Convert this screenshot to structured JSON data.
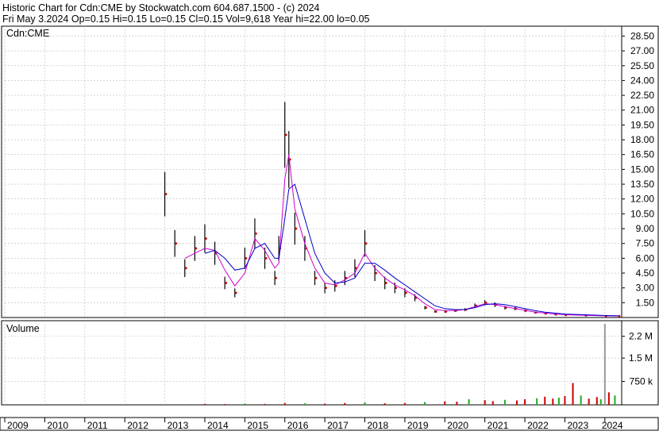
{
  "header": {
    "line1": "Historic Chart for Cdn:CME by Stockwatch.com 604.687.1500 - (c) 2024",
    "line2": "Fri May  3.2024   Op=0.15  Hi=0.15  Lo=0.15  Cl=0.15  Vol=9,618  Year hi=22.00  lo=0.05"
  },
  "colors": {
    "bars": "#000000",
    "close_dots": "#cc0000",
    "ma_short": "#cc00cc",
    "ma_long": "#0000cc",
    "volume_up": "#22aa22",
    "volume_down": "#cc0000",
    "grid": "#bdbdbd"
  },
  "chart_data": [
    {
      "type": "line",
      "title": "Cdn:CME",
      "xlabel": "",
      "ylabel": "",
      "ylim": [
        0,
        29.5
      ],
      "x_ticks": [
        "2009",
        "2010",
        "2011",
        "2012",
        "2013",
        "2014",
        "2015",
        "2016",
        "2017",
        "2018",
        "2019",
        "2020",
        "2021",
        "2022",
        "2023",
        "2024"
      ],
      "y_ticks": [
        "28.50",
        "27.00",
        "25.50",
        "24.00",
        "22.50",
        "21.00",
        "19.50",
        "18.00",
        "16.50",
        "15.00",
        "13.50",
        "12.00",
        "10.50",
        "9.00",
        "7.50",
        "6.00",
        "4.50",
        "3.00",
        "1.50"
      ],
      "grid": true,
      "x": [
        2013.0,
        2013.25,
        2013.5,
        2013.75,
        2014.0,
        2014.25,
        2014.5,
        2014.75,
        2015.0,
        2015.25,
        2015.5,
        2015.75,
        2015.85,
        2016.0,
        2016.1,
        2016.25,
        2016.5,
        2016.75,
        2017.0,
        2017.25,
        2017.5,
        2017.75,
        2018.0,
        2018.25,
        2018.5,
        2018.75,
        2019.0,
        2019.25,
        2019.5,
        2019.75,
        2020.0,
        2020.25,
        2020.5,
        2020.75,
        2021.0,
        2021.25,
        2021.5,
        2021.75,
        2022.0,
        2022.25,
        2022.5,
        2022.75,
        2023.0,
        2023.5,
        2024.0,
        2024.33
      ],
      "series": [
        {
          "values": [
            12.5,
            7.5,
            5.0,
            7.0,
            8.0,
            6.5,
            3.5,
            2.5,
            6.0,
            8.5,
            6.0,
            4.0,
            7.0,
            18.5,
            16.0,
            9.0,
            7.0,
            4.0,
            3.0,
            3.2,
            4.0,
            5.0,
            7.5,
            4.5,
            3.5,
            3.0,
            2.5,
            2.0,
            1.0,
            0.6,
            0.6,
            0.7,
            0.8,
            1.2,
            1.5,
            1.3,
            1.0,
            0.9,
            0.7,
            0.5,
            0.4,
            0.3,
            0.25,
            0.2,
            0.15,
            0.15
          ]
        },
        {
          "values": [
            null,
            null,
            6.0,
            6.5,
            7.0,
            6.8,
            4.8,
            3.2,
            4.5,
            8.0,
            6.8,
            5.0,
            5.5,
            14.0,
            16.5,
            11.0,
            7.5,
            5.0,
            3.5,
            3.3,
            3.8,
            4.5,
            6.5,
            5.0,
            4.0,
            3.3,
            2.8,
            2.2,
            1.4,
            0.8,
            0.7,
            0.7,
            0.8,
            1.1,
            1.4,
            1.3,
            1.1,
            0.9,
            0.75,
            0.55,
            0.45,
            0.35,
            0.28,
            0.22,
            0.17,
            0.15
          ]
        },
        {
          "values": [
            null,
            null,
            null,
            null,
            6.5,
            6.8,
            6.0,
            4.8,
            5.0,
            7.0,
            7.5,
            6.0,
            6.0,
            10.0,
            13.0,
            13.5,
            10.0,
            6.5,
            4.5,
            3.5,
            3.6,
            4.0,
            5.5,
            5.5,
            4.8,
            4.0,
            3.3,
            2.6,
            1.9,
            1.2,
            0.9,
            0.8,
            0.8,
            1.0,
            1.3,
            1.4,
            1.3,
            1.1,
            0.9,
            0.7,
            0.55,
            0.45,
            0.35,
            0.28,
            0.2,
            0.18
          ]
        }
      ]
    },
    {
      "type": "bar",
      "title": "Volume",
      "xlabel": "",
      "ylabel": "",
      "ylim": [
        0,
        2700000
      ],
      "y_ticks": [
        "2.2 M",
        "1.5 M",
        "750 k"
      ],
      "x": [
        2013.5,
        2014.0,
        2014.5,
        2015.0,
        2015.5,
        2016.0,
        2016.5,
        2017.0,
        2017.5,
        2018.0,
        2018.5,
        2019.0,
        2019.5,
        2020.0,
        2020.3,
        2020.6,
        2021.0,
        2021.2,
        2021.5,
        2021.8,
        2022.0,
        2022.3,
        2022.5,
        2022.7,
        2022.85,
        2023.0,
        2023.2,
        2023.4,
        2023.6,
        2023.8,
        2023.9,
        2024.0,
        2024.1,
        2024.25
      ],
      "values": [
        20000,
        30000,
        25000,
        40000,
        30000,
        60000,
        50000,
        40000,
        60000,
        80000,
        50000,
        60000,
        90000,
        110000,
        100000,
        180000,
        150000,
        120000,
        160000,
        140000,
        180000,
        210000,
        260000,
        200000,
        230000,
        280000,
        700000,
        300000,
        200000,
        250000,
        180000,
        2600000,
        400000,
        300000
      ]
    }
  ]
}
